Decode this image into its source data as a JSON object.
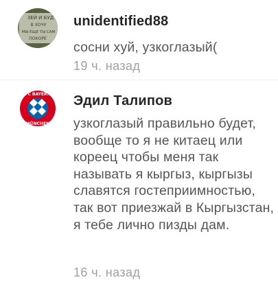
{
  "comments": [
    {
      "username": "unidentified88",
      "text": "сосни хуй, узкоглазый(",
      "time": "19 ч. назад",
      "avatar_icon": "stone-plaque-avatar-icon",
      "avatar_text": [
        "ЗЕЙ И БУД",
        "В ХОЧУ",
        "МЫ ЕЩЕ ТЫ САМ",
        "ПОКОРЕ"
      ]
    },
    {
      "username": "Эдил Талипов",
      "text": "узкоглазый правильно будет, вообще то я не китаец или кореец чтобы меня так называть я кыргыз, кыргызы славятся гостеприимностью, так вот приезжай в Кыргызстан, я тебе лично пизды дам.",
      "time": "16 ч. назад",
      "avatar_icon": "bayern-munich-logo-avatar-icon",
      "avatar_text": [
        "FC BAYERN",
        "MÜNCHEN"
      ]
    }
  ],
  "colors": {
    "username": "#262626",
    "text": "#555555",
    "time": "#a0a0a0",
    "background": "#ffffff"
  }
}
